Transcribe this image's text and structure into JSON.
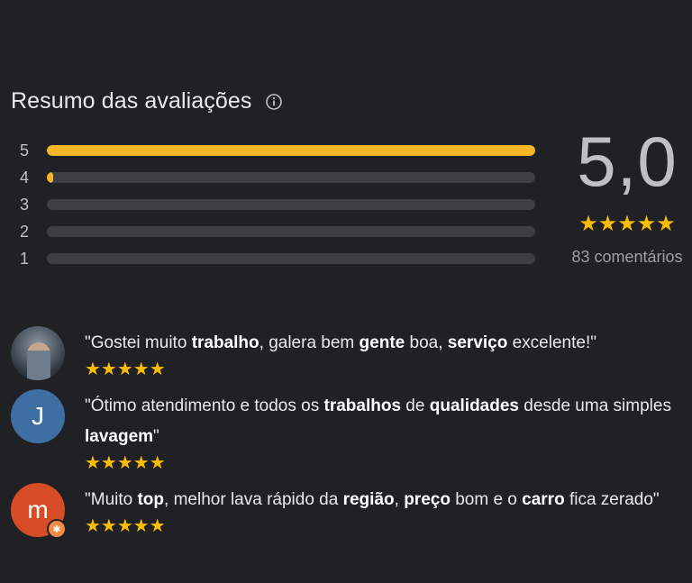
{
  "header": {
    "title": "Resumo das avaliações",
    "info_icon": "info-icon"
  },
  "rating_breakdown": [
    {
      "stars": "5",
      "fraction": 1.0
    },
    {
      "stars": "4",
      "fraction": 0.012
    },
    {
      "stars": "3",
      "fraction": 0.0
    },
    {
      "stars": "2",
      "fraction": 0.0
    },
    {
      "stars": "1",
      "fraction": 0.0
    }
  ],
  "summary": {
    "score": "5,0",
    "stars": 5,
    "count_text": "83 comentários"
  },
  "reviews": [
    {
      "avatar_type": "photo",
      "avatar_letter": "",
      "text": "\"Gostei muito <b>trabalho</b>, galera bem <b>gente</b> boa, <b>serviço</b> excelente!\"",
      "stars": 5
    },
    {
      "avatar_type": "blue",
      "avatar_letter": "J",
      "text": "\"Ótimo atendimento e todos os <b>trabalhos</b> de <b>qualidades</b> desde uma simples <b>lavagem</b>\"",
      "stars": 5
    },
    {
      "avatar_type": "orange",
      "avatar_letter": "m",
      "text": "\"Muito <b>top</b>, melhor lava rápido da <b>região</b>, <b>preço</b> bom e o <b>carro</b> fica zerado\"",
      "stars": 5
    }
  ],
  "colors": {
    "background": "#1f2125",
    "star": "#fbbc04",
    "bar_fill": "#f6b627",
    "bar_track": "#3c4043"
  }
}
